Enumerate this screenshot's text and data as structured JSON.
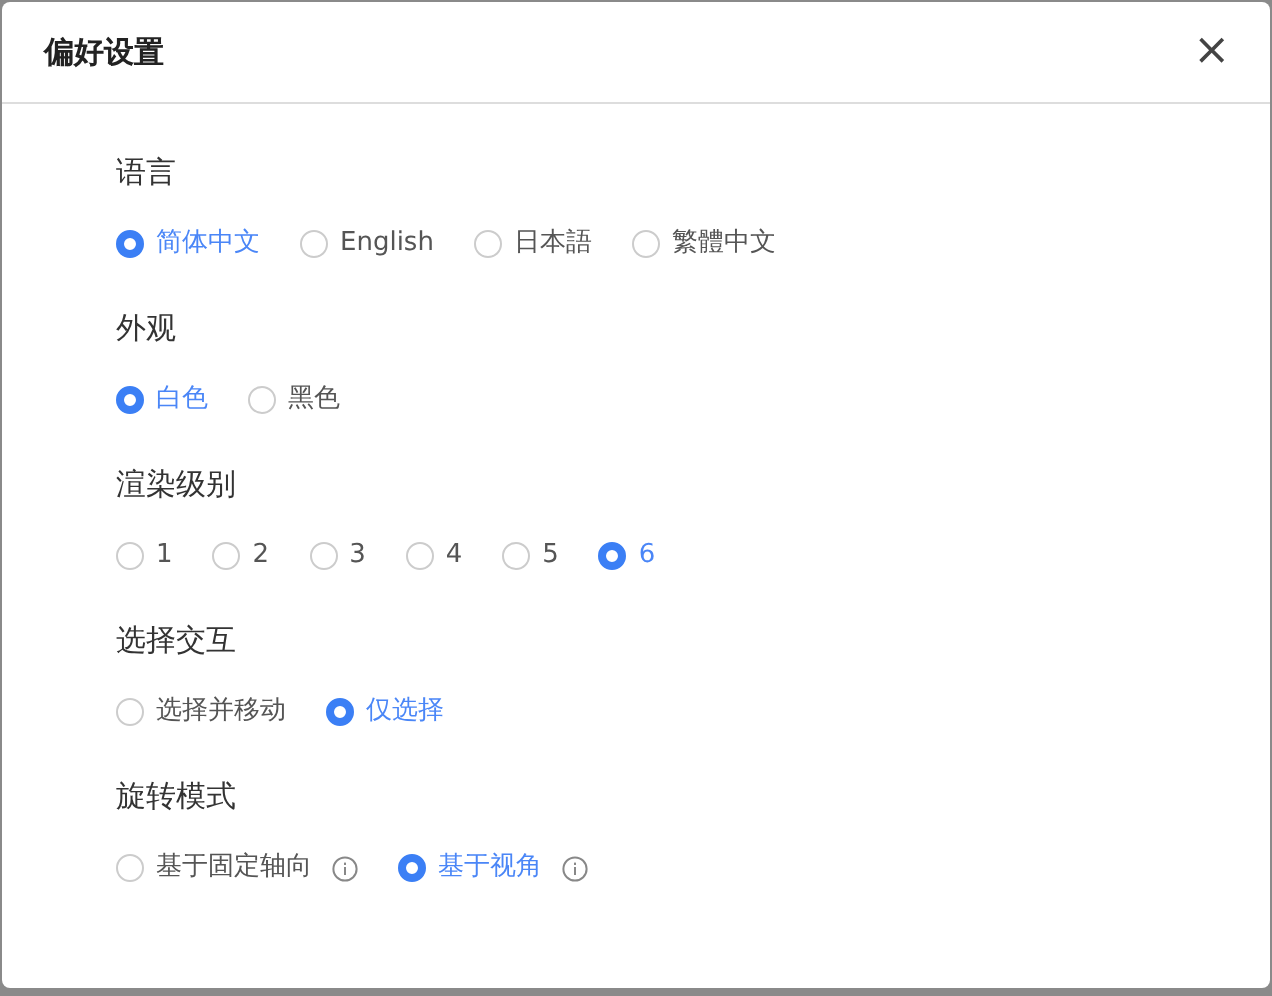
{
  "dialog": {
    "title": "偏好设置",
    "close": "×"
  },
  "sections": [
    {
      "label": "语言",
      "options": [
        {
          "label": "简体中文",
          "selected": true
        },
        {
          "label": "English",
          "selected": false
        },
        {
          "label": "日本語",
          "selected": false
        },
        {
          "label": "繁體中文",
          "selected": false
        }
      ]
    },
    {
      "label": "外观",
      "options": [
        {
          "label": "白色",
          "selected": true
        },
        {
          "label": "黑色",
          "selected": false
        }
      ]
    },
    {
      "label": "渲染级别",
      "options": [
        {
          "label": "1",
          "selected": false
        },
        {
          "label": "2",
          "selected": false
        },
        {
          "label": "3",
          "selected": false
        },
        {
          "label": "4",
          "selected": false
        },
        {
          "label": "5",
          "selected": false
        },
        {
          "label": "6",
          "selected": true
        }
      ]
    },
    {
      "label": "选择交互",
      "options": [
        {
          "label": "选择并移动",
          "selected": false
        },
        {
          "label": "仅选择",
          "selected": true
        }
      ]
    },
    {
      "label": "旋转模式",
      "options": [
        {
          "label": "基于固定轴向",
          "selected": false,
          "info": true
        },
        {
          "label": "基于视角",
          "selected": true,
          "info": true
        }
      ]
    }
  ]
}
